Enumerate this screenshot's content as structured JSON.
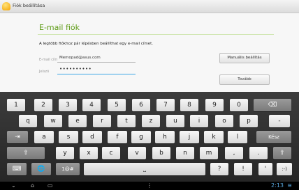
{
  "window": {
    "title": "Fiók beállítása"
  },
  "form": {
    "heading": "E-mail fiók",
    "intro": "A legtöbb fiókhoz pár lépésben beállíthat egy e-mail címet.",
    "email_label": "E-mail cím",
    "email_value": "Memopad@asus.com",
    "password_label": "Jelszó",
    "password_value": "••••••••••",
    "manual_button": "Manuális beállítás",
    "next_button": "Tovább"
  },
  "keyboard": {
    "row1": [
      "1",
      "2",
      "3",
      "4",
      "5",
      "6",
      "7",
      "8",
      "9",
      "0"
    ],
    "row2": [
      "q",
      "w",
      "e",
      "r",
      "t",
      "z",
      "u",
      "i",
      "o",
      "p",
      "-"
    ],
    "row3": [
      "a",
      "s",
      "d",
      "f",
      "g",
      "h",
      "j",
      "k",
      "l"
    ],
    "row3_enter": "Kész",
    "row4": [
      "y",
      "x",
      "c",
      "v",
      "b",
      "n",
      "m",
      ",",
      "."
    ],
    "sym_key": "1@#",
    "question": "?",
    "exclaim": "!",
    "apostrophe": "'",
    "smiley": ":-)",
    "backspace_icon": "⌫",
    "tab_icon": "⇥",
    "shift_icon": "⇧",
    "keyboard_icon": "⌨",
    "globe_icon": "🌐",
    "space_icon": "⎵"
  },
  "statusbar": {
    "back_icon": "⌄",
    "home_icon": "⌂",
    "recent_icon": "▭",
    "menu_icon": "⋮",
    "clock": "2:13",
    "wifi_icon": "≋"
  },
  "colors": {
    "accent": "#5e9b16",
    "focus": "#3aa6e6",
    "keyboard_bg": "#303030"
  }
}
